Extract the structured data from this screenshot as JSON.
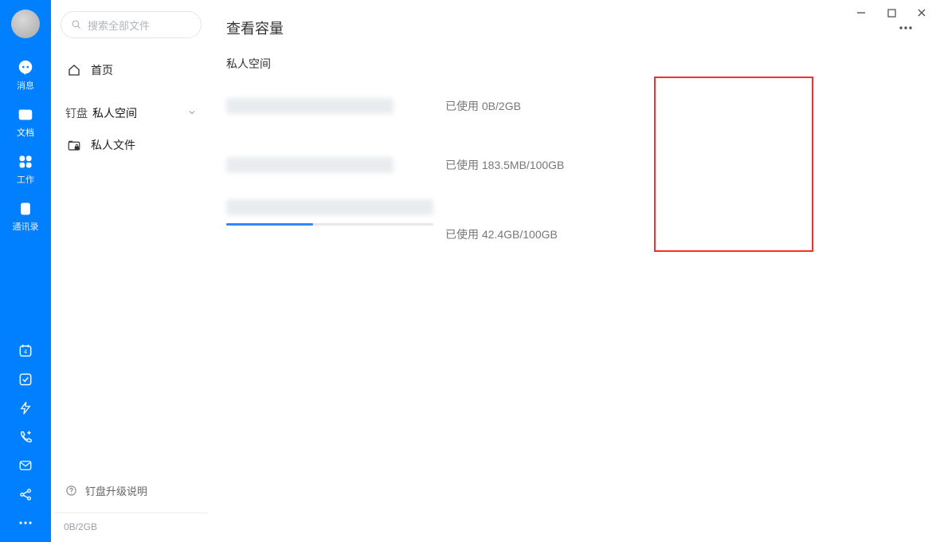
{
  "rail": {
    "items": [
      {
        "label": "消息"
      },
      {
        "label": "文档"
      },
      {
        "label": "工作"
      },
      {
        "label": "通讯录"
      }
    ]
  },
  "sidebar": {
    "search_placeholder": "搜索全部文件",
    "home_label": "首页",
    "tree_crumb1": "钉盘",
    "tree_crumb2": "私人空间",
    "private_files_label": "私人文件",
    "upgrade_label": "钉盘升级说明",
    "quota_foot": "0B/2GB"
  },
  "main": {
    "title": "查看容量",
    "section_label": "私人空间"
  },
  "storage": [
    {
      "usage_label": "已使用 0B/2GB",
      "bar": false,
      "pct": 0
    },
    {
      "usage_label": "已使用 183.5MB/100GB",
      "bar": false,
      "pct": 0.18
    },
    {
      "usage_label": "已使用 42.4GB/100GB",
      "bar": true,
      "pct": 42.4
    }
  ]
}
